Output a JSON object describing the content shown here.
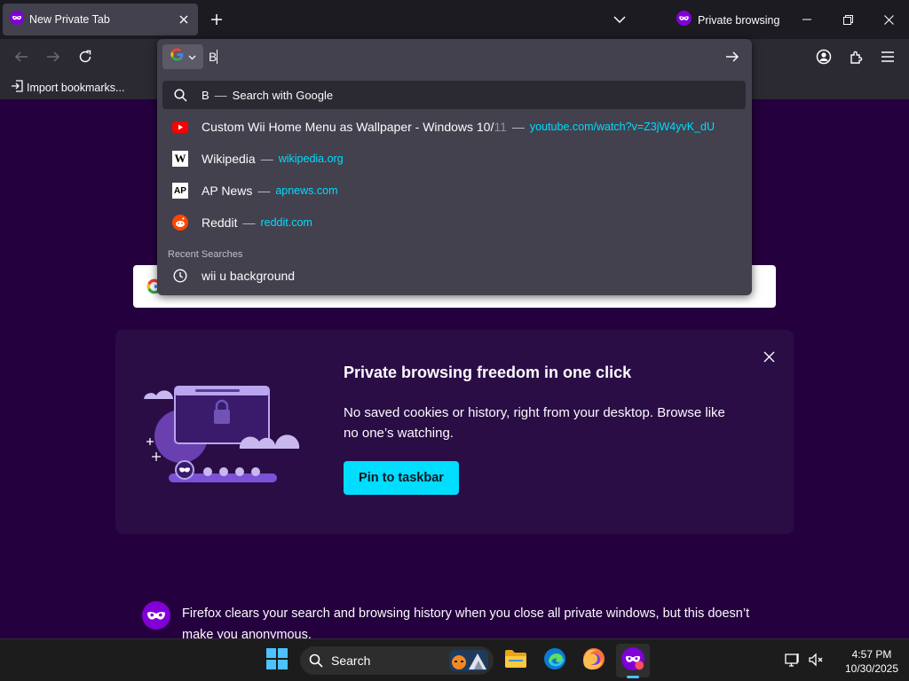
{
  "tab": {
    "title": "New Private Tab"
  },
  "window": {
    "private_label": "Private browsing"
  },
  "bookmarks": {
    "import_label": "Import bookmarks..."
  },
  "urlbar": {
    "value": "B",
    "suggestions": [
      {
        "kind": "search",
        "title": "B",
        "action": "Search with Google",
        "icon": "search-icon"
      },
      {
        "kind": "site",
        "title": "Custom Wii Home Menu as Wallpaper - Windows 10/",
        "title_fade": "11",
        "url": "youtube.com/watch?v=Z3jW4yvK_dU",
        "icon": "youtube-icon"
      },
      {
        "kind": "site",
        "title": "Wikipedia",
        "url": "wikipedia.org",
        "icon": "wikipedia-icon",
        "badge": "W"
      },
      {
        "kind": "site",
        "title": "AP News",
        "url": "apnews.com",
        "icon": "apnews-icon",
        "badge": "AP"
      },
      {
        "kind": "site",
        "title": "Reddit",
        "url": "reddit.com",
        "icon": "reddit-icon"
      }
    ],
    "recent_label": "Recent Searches",
    "recent": [
      {
        "title": "wii u background",
        "icon": "history-clock-icon"
      }
    ],
    "separator": "—"
  },
  "promo": {
    "title": "Private browsing freedom in one click",
    "text": "No saved cookies or history, right from your desktop. Browse like no one’s watching.",
    "button": "Pin to taskbar"
  },
  "info": {
    "text": "Firefox clears your search and browsing history when you close all private windows, but this doesn’t make you anonymous."
  },
  "taskbar": {
    "search_label": "Search",
    "time": "4:57 PM",
    "date": "10/30/2025"
  },
  "colors": {
    "accent": "#00ddff",
    "private_purple": "#25003e",
    "toolbar": "#2b2a33",
    "urlbar": "#42414d"
  }
}
